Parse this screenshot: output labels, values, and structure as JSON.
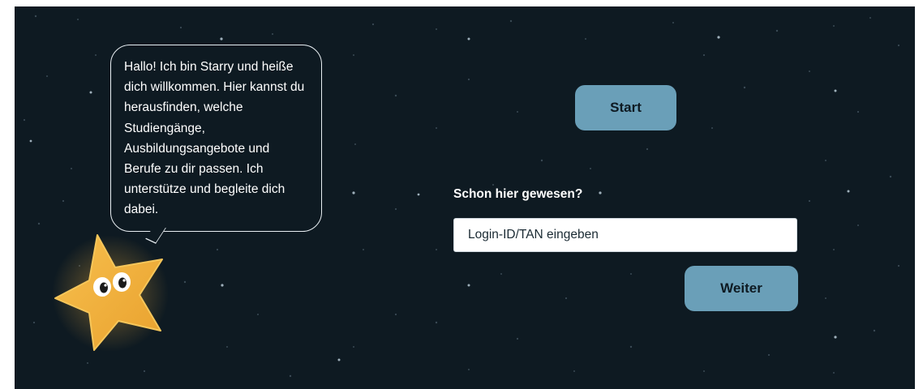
{
  "intro": {
    "speech_text": "Hallo! Ich bin Starry und heiße dich willkommen. Hier kannst du herausfinden, welche Studiengänge, Ausbildungsangebote und Berufe zu dir passen. Ich unterstütze und begleite dich dabei."
  },
  "actions": {
    "start_label": "Start",
    "returning_label": "Schon hier gewesen?",
    "login_placeholder": "Login-ID/TAN eingeben",
    "continue_label": "Weiter"
  },
  "colors": {
    "background": "#0e1a22",
    "button": "#6a9fb8",
    "button_text": "#0e1a22",
    "mascot": "#f4b23e"
  },
  "icons": {
    "mascot": "star-mascot-icon"
  }
}
